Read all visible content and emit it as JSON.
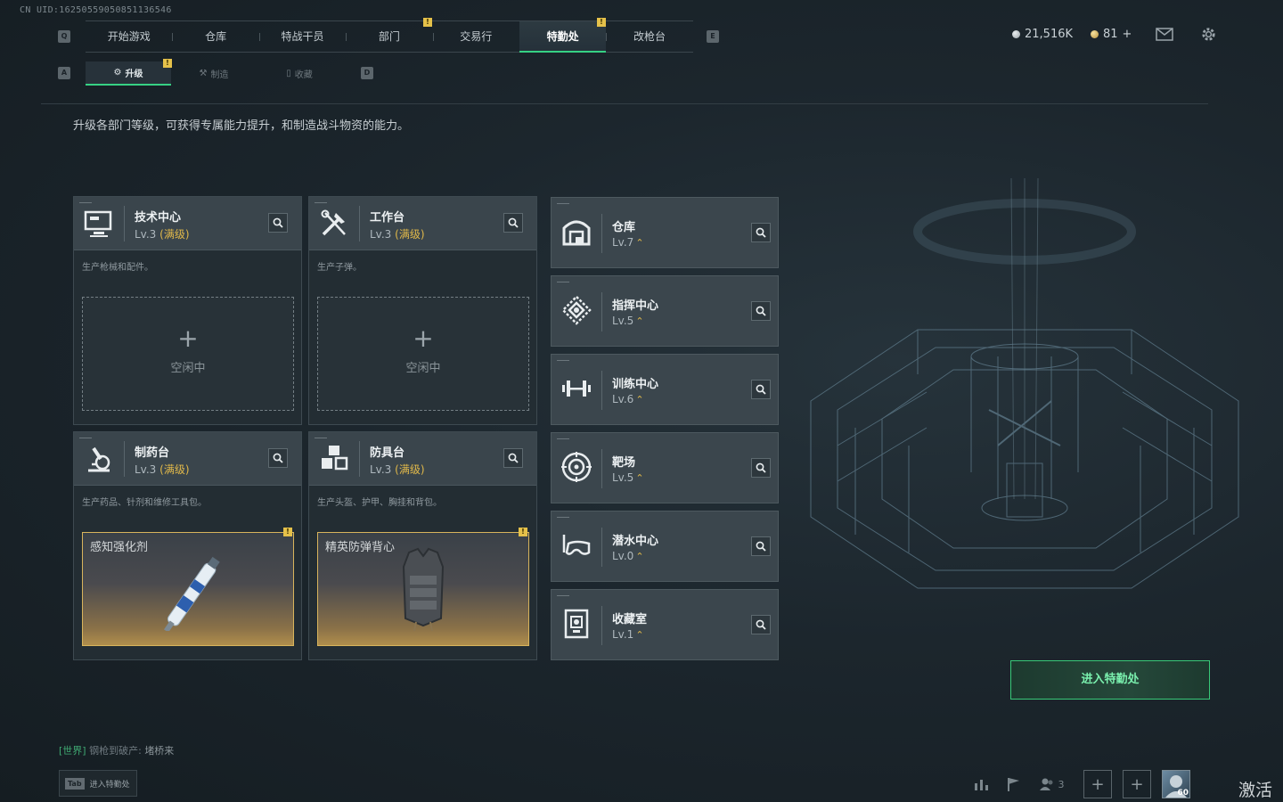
{
  "uid_text": "CN UID:16250559050851136546",
  "keys": {
    "top_left": "Q",
    "top_right": "E",
    "sub_left": "A",
    "sub_right": "D"
  },
  "top_nav": {
    "tabs": [
      {
        "label": "开始游戏"
      },
      {
        "label": "仓库"
      },
      {
        "label": "特战干员"
      },
      {
        "label": "部门"
      },
      {
        "label": "交易行"
      },
      {
        "label": "特勤处"
      },
      {
        "label": "改枪台"
      }
    ],
    "active_index": 5
  },
  "badge_mark": "!",
  "currency": {
    "silver": "21,516K",
    "gold": "81",
    "gold_add": "+"
  },
  "sub_nav": {
    "tabs": [
      {
        "label": "升级"
      },
      {
        "label": "制造"
      },
      {
        "label": "收藏"
      }
    ],
    "active_index": 0
  },
  "description": "升级各部门等级，可获得专属能力提升，和制造战斗物资的能力。",
  "departments": [
    {
      "name": "技术中心",
      "level": "Lv.3",
      "max_label": "(满级)",
      "desc": "生产枪械和配件。",
      "slot": {
        "type": "empty",
        "label": "空闲中",
        "plus": "+"
      }
    },
    {
      "name": "工作台",
      "level": "Lv.3",
      "max_label": "(满级)",
      "desc": "生产子弹。",
      "slot": {
        "type": "empty",
        "label": "空闲中",
        "plus": "+"
      }
    },
    {
      "name": "制药台",
      "level": "Lv.3",
      "max_label": "(满级)",
      "desc": "生产药品、针剂和维修工具包。",
      "slot": {
        "type": "item",
        "label": "感知强化剂"
      }
    },
    {
      "name": "防具台",
      "level": "Lv.3",
      "max_label": "(满级)",
      "desc": "生产头盔、护甲、胸挂和背包。",
      "slot": {
        "type": "item",
        "label": "精英防弹背心"
      }
    }
  ],
  "facilities": [
    {
      "name": "仓库",
      "level": "Lv.7"
    },
    {
      "name": "指挥中心",
      "level": "Lv.5"
    },
    {
      "name": "训练中心",
      "level": "Lv.6"
    },
    {
      "name": "靶场",
      "level": "Lv.5"
    },
    {
      "name": "潜水中心",
      "level": "Lv.0"
    },
    {
      "name": "收藏室",
      "level": "Lv.1"
    }
  ],
  "up_arrow": "⌃",
  "enter_button": "进入特勤处",
  "chat": {
    "channel": "[世界]",
    "sender": "钢枪到破产:",
    "message": "堵桥来"
  },
  "tab_hint": {
    "key": "Tab",
    "label": "进入特勤处"
  },
  "bottom_bar": {
    "friends_count": "3",
    "level_badge": "60",
    "plus": "+"
  },
  "activate_text": "激活"
}
